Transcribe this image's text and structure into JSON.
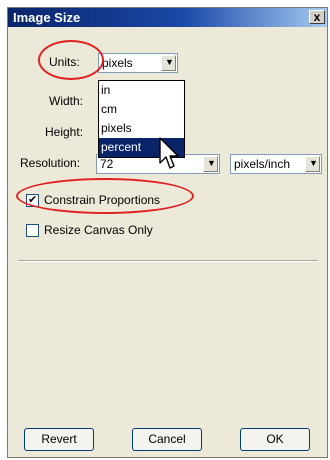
{
  "window": {
    "title": "Image Size",
    "close": "x"
  },
  "units": {
    "label": "Units:",
    "value": "pixels",
    "options": [
      "in",
      "cm",
      "pixels",
      "percent"
    ],
    "highlighted": "percent"
  },
  "width": {
    "label": "Width:"
  },
  "height": {
    "label": "Height:"
  },
  "resolution": {
    "label": "Resolution:",
    "value": "72",
    "unit": "pixels/inch"
  },
  "constrain": {
    "label": "Constrain Proportions",
    "checked": true
  },
  "resize_canvas": {
    "label": "Resize Canvas Only",
    "checked": false
  },
  "buttons": {
    "revert": "Revert",
    "cancel": "Cancel",
    "ok": "OK"
  },
  "colors": {
    "annotation": "#e02020",
    "selection": "#0a246a",
    "title_bar": "#0a246a"
  },
  "icons": {
    "dropdown": "chevron-down-icon",
    "cursor": "arrow-cursor-icon",
    "check": "check-icon"
  }
}
